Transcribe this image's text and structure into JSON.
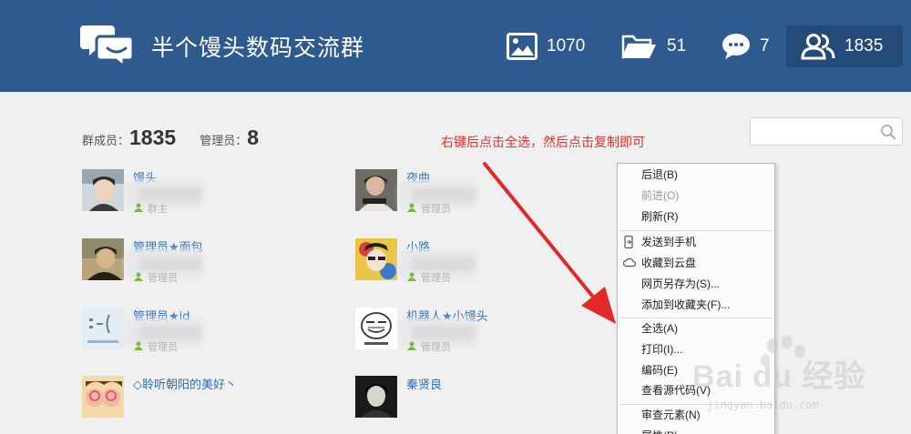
{
  "header": {
    "title": "半个馒头数码交流群",
    "stats": {
      "photos": "1070",
      "files": "51",
      "chats": "7",
      "members": "1835"
    }
  },
  "summary": {
    "member_label": "群成员：",
    "member_count": "1835",
    "admin_label": "管理员：",
    "admin_count": "8"
  },
  "search": {
    "placeholder": "",
    "value": ""
  },
  "hint": "右键后点击全选，然后点击复制即可",
  "members": [
    {
      "name": "馒头",
      "role": "群主"
    },
    {
      "name": "夜曲",
      "role": "管理员"
    },
    {
      "name": "管理员★面包",
      "role": "管理员"
    },
    {
      "name": "小路",
      "role": "管理员"
    },
    {
      "name": "管理员★id",
      "role": "管理员"
    },
    {
      "name": "机器人★小馒头",
      "role": "管理员"
    },
    {
      "name": "◇聆听朝阳的美好丶",
      "role": ""
    },
    {
      "name": "秦贤良",
      "role": ""
    }
  ],
  "context_menu": {
    "back": "后退(B)",
    "forward": "前进(O)",
    "refresh": "刷新(R)",
    "send_to_phone": "发送到手机",
    "save_to_cloud": "收藏到云盘",
    "save_as": "网页另存为(S)...",
    "add_favorite": "添加到收藏夹(F)...",
    "select_all": "全选(A)",
    "print": "打印(I)...",
    "encoding": "编码(E)",
    "view_source": "查看源代码(V)",
    "inspect": "审查元素(N)",
    "properties": "属性(P)"
  },
  "watermark": {
    "brand": "Bai du 经验",
    "url": "jingyan.baidu.com"
  },
  "colors": {
    "header_bg": "#2f5a8f",
    "accent": "#2f6fb5",
    "hint": "#e0312e"
  }
}
